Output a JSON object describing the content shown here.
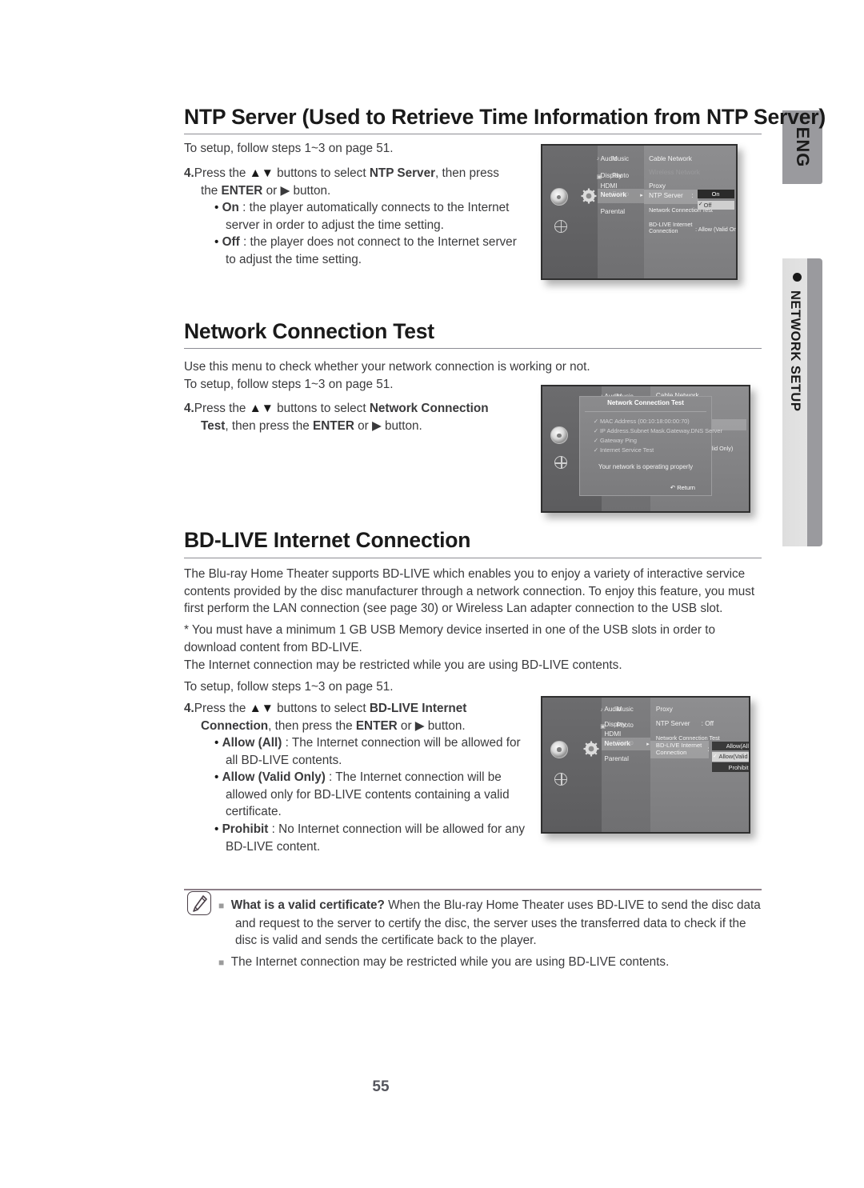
{
  "page": {
    "number": "55",
    "lang_tab": "ENG",
    "side_tab": "NETWORK SETUP"
  },
  "sections": {
    "ntp": {
      "heading": "NTP Server (Used to Retrieve Time Information from NTP Server)",
      "intro": "To setup, follow steps 1~3 on page 51.",
      "step_num": "4.",
      "step_a": "Press the ",
      "step_arrows": "▲▼",
      "step_b": " buttons to select ",
      "step_bold1": "NTP Server",
      "step_c": ", then press the ",
      "step_bold2": "ENTER",
      "step_d": " or ▶ button.",
      "bullets": [
        {
          "label": "On",
          "text": " : the player automatically connects to the Internet server in order to adjust the time setting."
        },
        {
          "label": "Off",
          "text": " : the player does not connect to the Internet server to adjust the time setting."
        }
      ]
    },
    "nct": {
      "heading": "Network Connection Test",
      "line1": "Use this menu to check whether your network connection is working or not.",
      "line2": "To setup, follow steps 1~3 on page 51.",
      "step_num": "4.",
      "step_a": "Press the ",
      "step_arrows": "▲▼",
      "step_b": " buttons to select ",
      "step_bold1": "Network Connection Test",
      "step_c": ", then press the ",
      "step_bold2": "ENTER",
      "step_d": " or ▶ button."
    },
    "bdlive": {
      "heading": "BD-LIVE Internet Connection",
      "para1": "The Blu-ray Home Theater supports BD-LIVE which enables you to enjoy a variety of interactive service contents provided by the disc manufacturer through a network connection. To enjoy this feature, you must first perform the LAN connection (see page 30) or Wireless Lan adapter connection to the USB slot.",
      "para2": "* You must have a minimum 1 GB USB Memory device inserted in one of the USB slots in order to download content from BD-LIVE.",
      "para3": "The Internet connection may be restricted while you are using BD-LIVE contents.",
      "para4": "To setup, follow steps 1~3 on page 51.",
      "step_num": "4.",
      "step_a": "Press the ",
      "step_arrows": "▲▼",
      "step_b": " buttons to select ",
      "step_bold1": "BD-LIVE Internet Connection",
      "step_c": ", then press the ",
      "step_bold2": "ENTER",
      "step_d": " or ▶ button.",
      "bullets": [
        {
          "label": "Allow (All)",
          "text": " : The Internet connection will be allowed for all BD-LIVE contents."
        },
        {
          "label": "Allow (Valid Only)",
          "text": " : The Internet connection will be allowed only for BD-LIVE contents containing a valid certificate."
        },
        {
          "label": "Prohibit",
          "text": " : No Internet connection will be allowed for any BD-LIVE content."
        }
      ]
    }
  },
  "note": {
    "icon": "pencil-note-icon",
    "items": [
      {
        "bold": "What is a valid certificate?",
        "text": " When the Blu-ray Home Theater uses BD-LIVE to send the disc data and request to the server to certify the disc, the server uses the transferred data to check if the disc is valid and sends the certificate back to the player."
      },
      {
        "bold": "",
        "text": "The Internet connection may be restricted while you are using BD-LIVE contents."
      }
    ]
  },
  "tv_screens": {
    "ntp": {
      "left_menu": [
        "Music",
        "Photo",
        "Setup"
      ],
      "mid_menu": [
        "Audio",
        "Display",
        "HDMI",
        "Network",
        "Parental"
      ],
      "mid_selected": "Network",
      "right_menu": [
        {
          "label": "Cable Network",
          "value": ""
        },
        {
          "label": "Wireless Network",
          "value": "",
          "dim": true
        },
        {
          "label": "Proxy",
          "value": ""
        },
        {
          "label": "NTP Server",
          "value": ":"
        },
        {
          "label": "Network Connection Test",
          "value": ""
        },
        {
          "label": "BD-LIVE Internet Connection",
          "value": ": Allow (Valid Only)"
        }
      ],
      "dropdown": {
        "options": [
          "On",
          "Off"
        ],
        "selected": "On",
        "checked": "Off"
      }
    },
    "nct": {
      "left_menu": [
        "Music"
      ],
      "mid_menu": [
        "Audio"
      ],
      "right_menu": [
        "Cable Network"
      ],
      "dialog": {
        "title": "Network Connection Test",
        "checks": [
          "MAC Address (00:10:18:00:00:70)",
          "IP Address.Subnet Mask.Gateway.DNS Server",
          "Gateway Ping",
          "Internet Service Test"
        ],
        "message": "Your network is operating properly",
        "return_label": "Return"
      },
      "behind_value": "(Valid Only)"
    },
    "bdlive": {
      "left_menu": [
        "Music",
        "Photo",
        "Setup"
      ],
      "mid_menu": [
        "Audio",
        "Display",
        "HDMI",
        "Network",
        "Parental"
      ],
      "mid_selected": "Network",
      "right_menu": [
        {
          "label": "Proxy",
          "value": ""
        },
        {
          "label": "NTP Server",
          "value": ": Off"
        },
        {
          "label": "Network Connection Test",
          "value": ""
        },
        {
          "label": "BD-LIVE Internet Connection",
          "value": ":"
        }
      ],
      "dropdown": {
        "options": [
          "Allow(All)",
          "Allow(Valid Only)",
          "Prohibit"
        ],
        "selected": "Allow(All)",
        "checked": "Allow(Valid Only)"
      }
    }
  }
}
